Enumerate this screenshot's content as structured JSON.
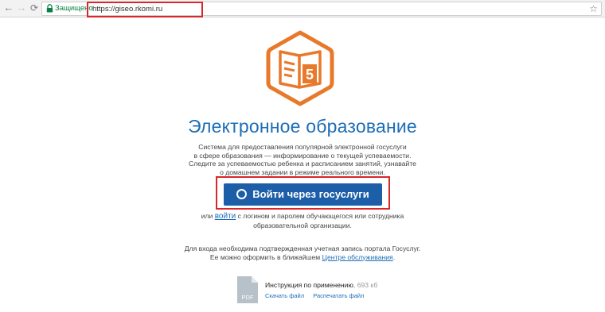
{
  "browser": {
    "secure_label": "Защищено",
    "url": "https://giseo.rkomi.ru"
  },
  "logo": {
    "digit": "5",
    "color": "#e8792a"
  },
  "main": {
    "title": "Электронное образование",
    "description": {
      "line1": "Система для предоставления популярной электронной госуслуги",
      "line2": "в сфере образования — информирование о текущей успеваемости.",
      "line3": "Следите за успеваемостью ребенка и расписанием занятий, узнавайте",
      "line4": "о домашнем задании в режиме реального времени."
    },
    "cta_label": "Войти через госуслуги",
    "alt_login": {
      "prefix": "или",
      "link": "войти",
      "suffix_line1": "с логином и паролем обучающегося или сотрудника",
      "line2": "образовательной организации."
    },
    "note": {
      "line1": "Для входа необходима подтвержденная учетная запись портала Госуслуг.",
      "line2_prefix": "Ее можно оформить в ближайшем",
      "line2_link": "Центре обслуживания",
      "line2_suffix": "."
    }
  },
  "document": {
    "icon_label": "PDF",
    "title": "Инструкция по применению",
    "size": ", 693 кб",
    "download": "Скачать файл",
    "print": "Распечатать файл"
  },
  "colors": {
    "brand_blue": "#1c6db7",
    "button_blue": "#1c5ea8",
    "highlight_red": "#d9262b"
  }
}
